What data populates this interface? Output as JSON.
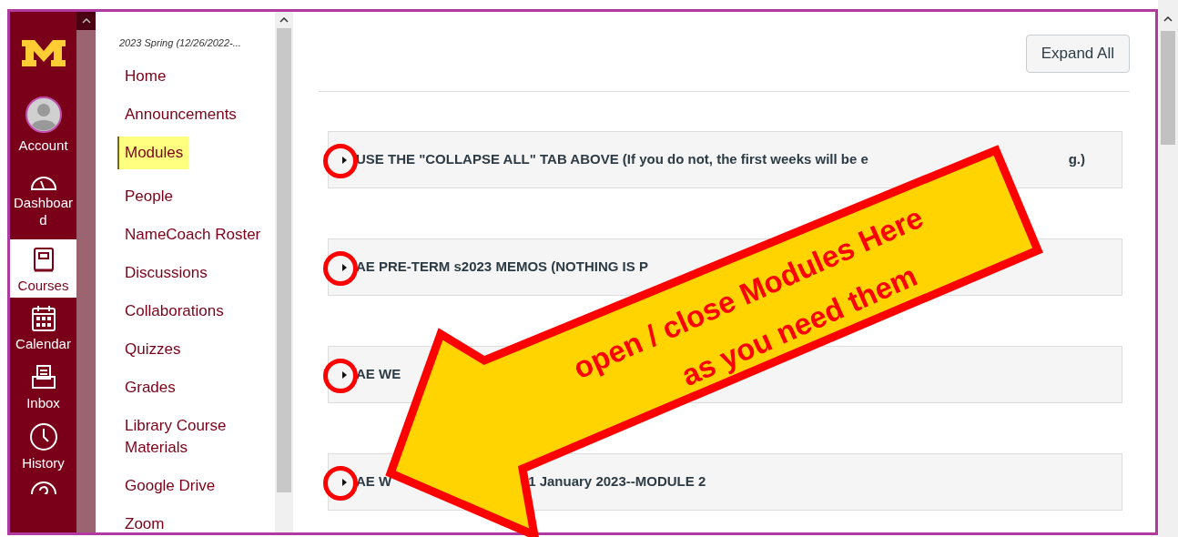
{
  "global_nav": [
    {
      "kind": "logo"
    },
    {
      "kind": "account",
      "label": "Account",
      "selected": false
    },
    {
      "kind": "dashboard",
      "label": "Dashboard",
      "selected": false
    },
    {
      "kind": "courses",
      "label": "Courses",
      "selected": true
    },
    {
      "kind": "calendar",
      "label": "Calendar",
      "selected": false
    },
    {
      "kind": "inbox",
      "label": "Inbox",
      "selected": false
    },
    {
      "kind": "history",
      "label": "History",
      "selected": false
    },
    {
      "kind": "help",
      "selected": false
    }
  ],
  "course_nav": {
    "term": "2023 Spring (12/26/2022-...",
    "items": [
      {
        "label": "Home",
        "selected": false,
        "highlighted": false
      },
      {
        "label": "Announcements",
        "selected": false,
        "highlighted": false
      },
      {
        "label": "Modules",
        "selected": true,
        "highlighted": true
      },
      {
        "label": "People",
        "selected": false,
        "highlighted": false
      },
      {
        "label": "NameCoach Roster",
        "selected": false,
        "highlighted": false
      },
      {
        "label": "Discussions",
        "selected": false,
        "highlighted": false
      },
      {
        "label": "Collaborations",
        "selected": false,
        "highlighted": false
      },
      {
        "label": "Quizzes",
        "selected": false,
        "highlighted": false
      },
      {
        "label": "Grades",
        "selected": false,
        "highlighted": false
      },
      {
        "label": "Library Course Materials",
        "selected": false,
        "highlighted": false
      },
      {
        "label": "Google Drive",
        "selected": false,
        "highlighted": false
      },
      {
        "label": "Zoom",
        "selected": false,
        "highlighted": false
      }
    ]
  },
  "content": {
    "expand_all": "Expand All",
    "modules": [
      {
        "title": "USE THE \"COLLAPSE ALL\" TAB ABOVE (If you do not, the first weeks will be e",
        "title_end": "g.)",
        "expanded": false
      },
      {
        "title": "AE PRE-TERM s2023 MEMOS (NOTHING IS P",
        "expanded": false
      },
      {
        "title": "AE WE",
        "expanded": false
      },
      {
        "title": "AE W",
        "title_end": "1 January 2023--MODULE 2",
        "expanded": false
      }
    ]
  },
  "annotation": {
    "line_1": "open / close Modules Here",
    "line_2": "as you need them"
  }
}
